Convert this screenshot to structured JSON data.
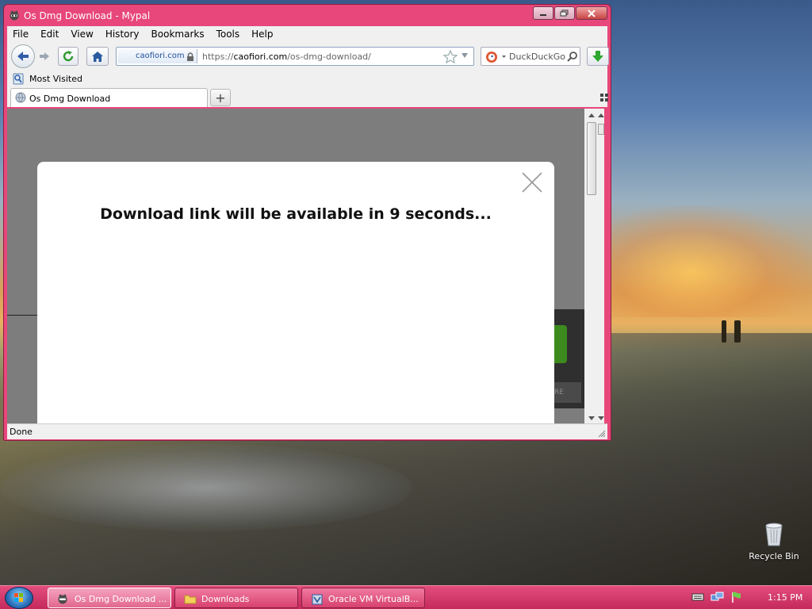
{
  "window": {
    "title": "Os Dmg Download - Mypal"
  },
  "menu": [
    "File",
    "Edit",
    "View",
    "History",
    "Bookmarks",
    "Tools",
    "Help"
  ],
  "navbar": {
    "identity": "caofiori.com",
    "url_scheme": "https://",
    "url_host": "caofiori.com",
    "url_path": "/os-dmg-download/",
    "search_placeholder": "DuckDuckGo"
  },
  "bookmarks": {
    "most_visited": "Most Visited"
  },
  "tabs": [
    {
      "label": "Os Dmg Download"
    }
  ],
  "page": {
    "modal_message": "Download link will be available in 9 seconds...",
    "bg_button_text": "RE"
  },
  "status": {
    "text": "Done"
  },
  "desktop": {
    "recycle_bin": "Recycle Bin"
  },
  "taskbar": {
    "items": [
      {
        "label": "Os Dmg Download ...",
        "icon": "mypal-icon",
        "active": true
      },
      {
        "label": "Downloads",
        "icon": "folder-icon",
        "active": false
      },
      {
        "label": "Oracle VM VirtualB...",
        "icon": "virtualbox-icon",
        "active": false
      }
    ],
    "clock": "1:15 PM"
  },
  "colors": {
    "window_frame": "#e7477a",
    "taskbar": "#d8416f",
    "download_arrow": "#2fa82f"
  }
}
